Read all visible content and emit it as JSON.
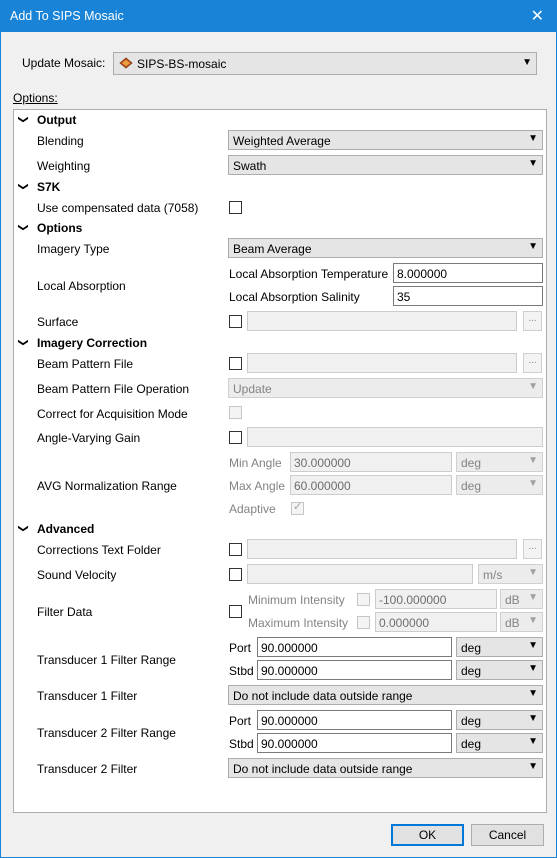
{
  "window": {
    "title": "Add To SIPS Mosaic",
    "close_glyph": "✕"
  },
  "update_mosaic": {
    "label": "Update Mosaic:",
    "value": "SIPS-BS-mosaic",
    "icon": "mosaic-layer-icon"
  },
  "options_label": "Options:",
  "sections": {
    "output": "Output",
    "s7k": "S7K",
    "options": "Options",
    "imagery_correction": "Imagery Correction",
    "advanced": "Advanced"
  },
  "output": {
    "blending_label": "Blending",
    "blending_value": "Weighted Average",
    "weighting_label": "Weighting",
    "weighting_value": "Swath"
  },
  "s7k": {
    "compensated_label": "Use compensated data (7058)",
    "compensated_checked": false
  },
  "options": {
    "imagery_type_label": "Imagery Type",
    "imagery_type_value": "Beam Average",
    "local_absorption_label": "Local Absorption",
    "temperature_label": "Local Absorption Temperature",
    "temperature_value": "8.000000",
    "salinity_label": "Local Absorption Salinity",
    "salinity_value": "35",
    "surface_label": "Surface",
    "browse_glyph": "..."
  },
  "imagery_correction": {
    "beam_pattern_file_label": "Beam Pattern File",
    "beam_pattern_op_label": "Beam Pattern File Operation",
    "beam_pattern_op_value": "Update",
    "acq_mode_label": "Correct for Acquisition Mode",
    "avg_gain_label": "Angle-Varying Gain",
    "avg_range_label": "AVG Normalization Range",
    "min_angle_label": "Min Angle",
    "min_angle_value": "30.000000",
    "min_angle_unit": "deg",
    "max_angle_label": "Max Angle",
    "max_angle_value": "60.000000",
    "max_angle_unit": "deg",
    "adaptive_label": "Adaptive"
  },
  "advanced": {
    "corrections_folder_label": "Corrections Text Folder",
    "sound_velocity_label": "Sound Velocity",
    "sound_velocity_unit": "m/s",
    "filter_data_label": "Filter Data",
    "min_intensity_label": "Minimum Intensity",
    "min_intensity_value": "-100.000000",
    "min_intensity_unit": "dB",
    "max_intensity_label": "Maximum Intensity",
    "max_intensity_value": "0.000000",
    "max_intensity_unit": "dB",
    "t1_range_label": "Transducer 1 Filter Range",
    "t1_port_label": "Port",
    "t1_port_value": "90.000000",
    "t1_port_unit": "deg",
    "t1_stbd_label": "Stbd",
    "t1_stbd_value": "90.000000",
    "t1_stbd_unit": "deg",
    "t1_filter_label": "Transducer 1 Filter",
    "t1_filter_value": "Do not include data outside range",
    "t2_range_label": "Transducer 2 Filter Range",
    "t2_port_label": "Port",
    "t2_port_value": "90.000000",
    "t2_port_unit": "deg",
    "t2_stbd_label": "Stbd",
    "t2_stbd_value": "90.000000",
    "t2_stbd_unit": "deg",
    "t2_filter_label": "Transducer 2 Filter",
    "t2_filter_value": "Do not include data outside range"
  },
  "footer": {
    "ok_label": "OK",
    "cancel_label": "Cancel"
  },
  "colors": {
    "titlebar": "#1883d7",
    "accent": "#0078d7"
  }
}
